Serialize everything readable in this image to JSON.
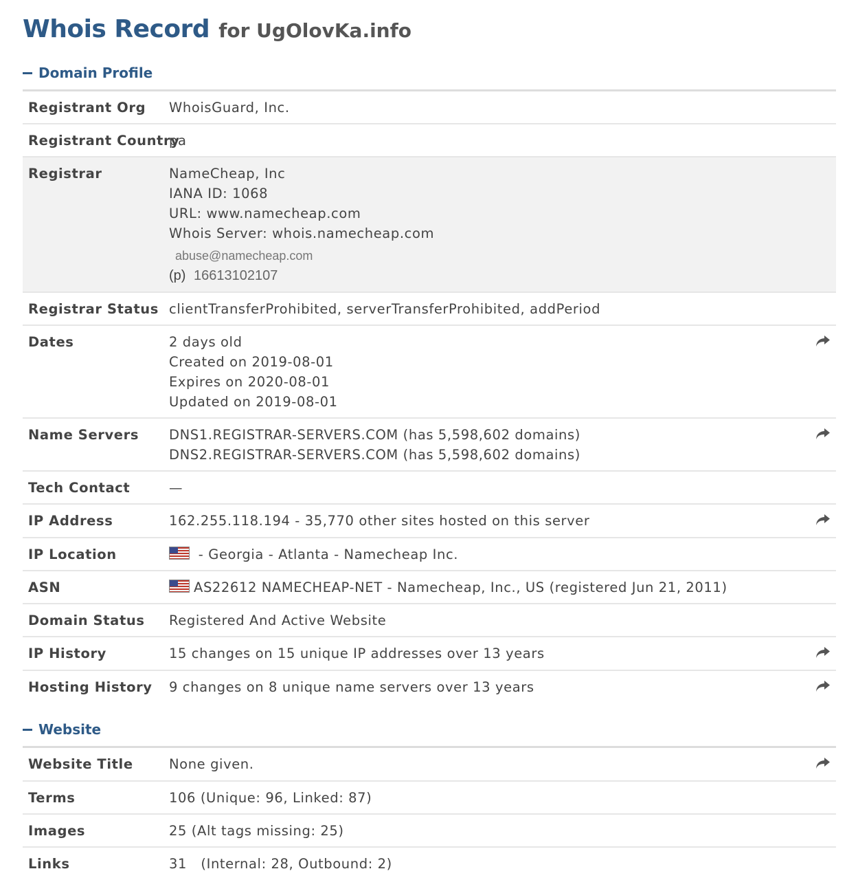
{
  "header": {
    "title_main": "Whois Record",
    "title_sub": "for UgOlovKa.info"
  },
  "sections": {
    "domain_profile": "Domain Profile",
    "website": "Website"
  },
  "domain_profile": {
    "registrant_org": {
      "label": "Registrant Org",
      "value": "WhoisGuard, Inc."
    },
    "registrant_country": {
      "label": "Registrant Country",
      "value": "pa"
    },
    "registrar": {
      "label": "Registrar",
      "name": "NameCheap, Inc",
      "iana": "IANA ID: 1068",
      "url": "URL: www.namecheap.com",
      "whois_server": "Whois Server: whois.namecheap.com",
      "abuse": "abuse@namecheap.com",
      "phone_prefix": "(p)",
      "phone": "16613102107"
    },
    "registrar_status": {
      "label": "Registrar Status",
      "value": "clientTransferProhibited, serverTransferProhibited, addPeriod"
    },
    "dates": {
      "label": "Dates",
      "age": "2 days old",
      "created": "Created on 2019-08-01",
      "expires": "Expires on 2020-08-01",
      "updated": "Updated on 2019-08-01"
    },
    "name_servers": {
      "label": "Name Servers",
      "ns1": "DNS1.REGISTRAR-SERVERS.COM (has 5,598,602 domains)",
      "ns2": "DNS2.REGISTRAR-SERVERS.COM (has 5,598,602 domains)"
    },
    "tech_contact": {
      "label": "Tech Contact",
      "value": "—"
    },
    "ip_address": {
      "label": "IP Address",
      "value": "162.255.118.194 - 35,770 other sites hosted on this server"
    },
    "ip_location": {
      "label": "IP Location",
      "value": " - Georgia - Atlanta - Namecheap Inc."
    },
    "asn": {
      "label": "ASN",
      "value": "AS22612 NAMECHEAP-NET - Namecheap, Inc., US (registered Jun 21, 2011)"
    },
    "domain_status": {
      "label": "Domain Status",
      "value": "Registered And Active Website"
    },
    "ip_history": {
      "label": "IP History",
      "value": "15 changes on 15 unique IP addresses over 13 years"
    },
    "hosting_history": {
      "label": "Hosting History",
      "value": "9 changes on 8 unique name servers over 13 years"
    }
  },
  "website": {
    "title": {
      "label": "Website Title",
      "value": "None given."
    },
    "terms": {
      "label": "Terms",
      "value": "106 (Unique: 96, Linked: 87)"
    },
    "images": {
      "label": "Images",
      "value": "25 (Alt tags missing: 25)"
    },
    "links": {
      "label": "Links",
      "value": "31   (Internal: 28, Outbound: 2)"
    }
  },
  "icons": {
    "share": "share-arrow-icon",
    "flag": "us-flag-icon"
  },
  "colors": {
    "heading": "#2e5a87",
    "row_shade": "#f2f2f2",
    "rule": "#dddddd"
  }
}
